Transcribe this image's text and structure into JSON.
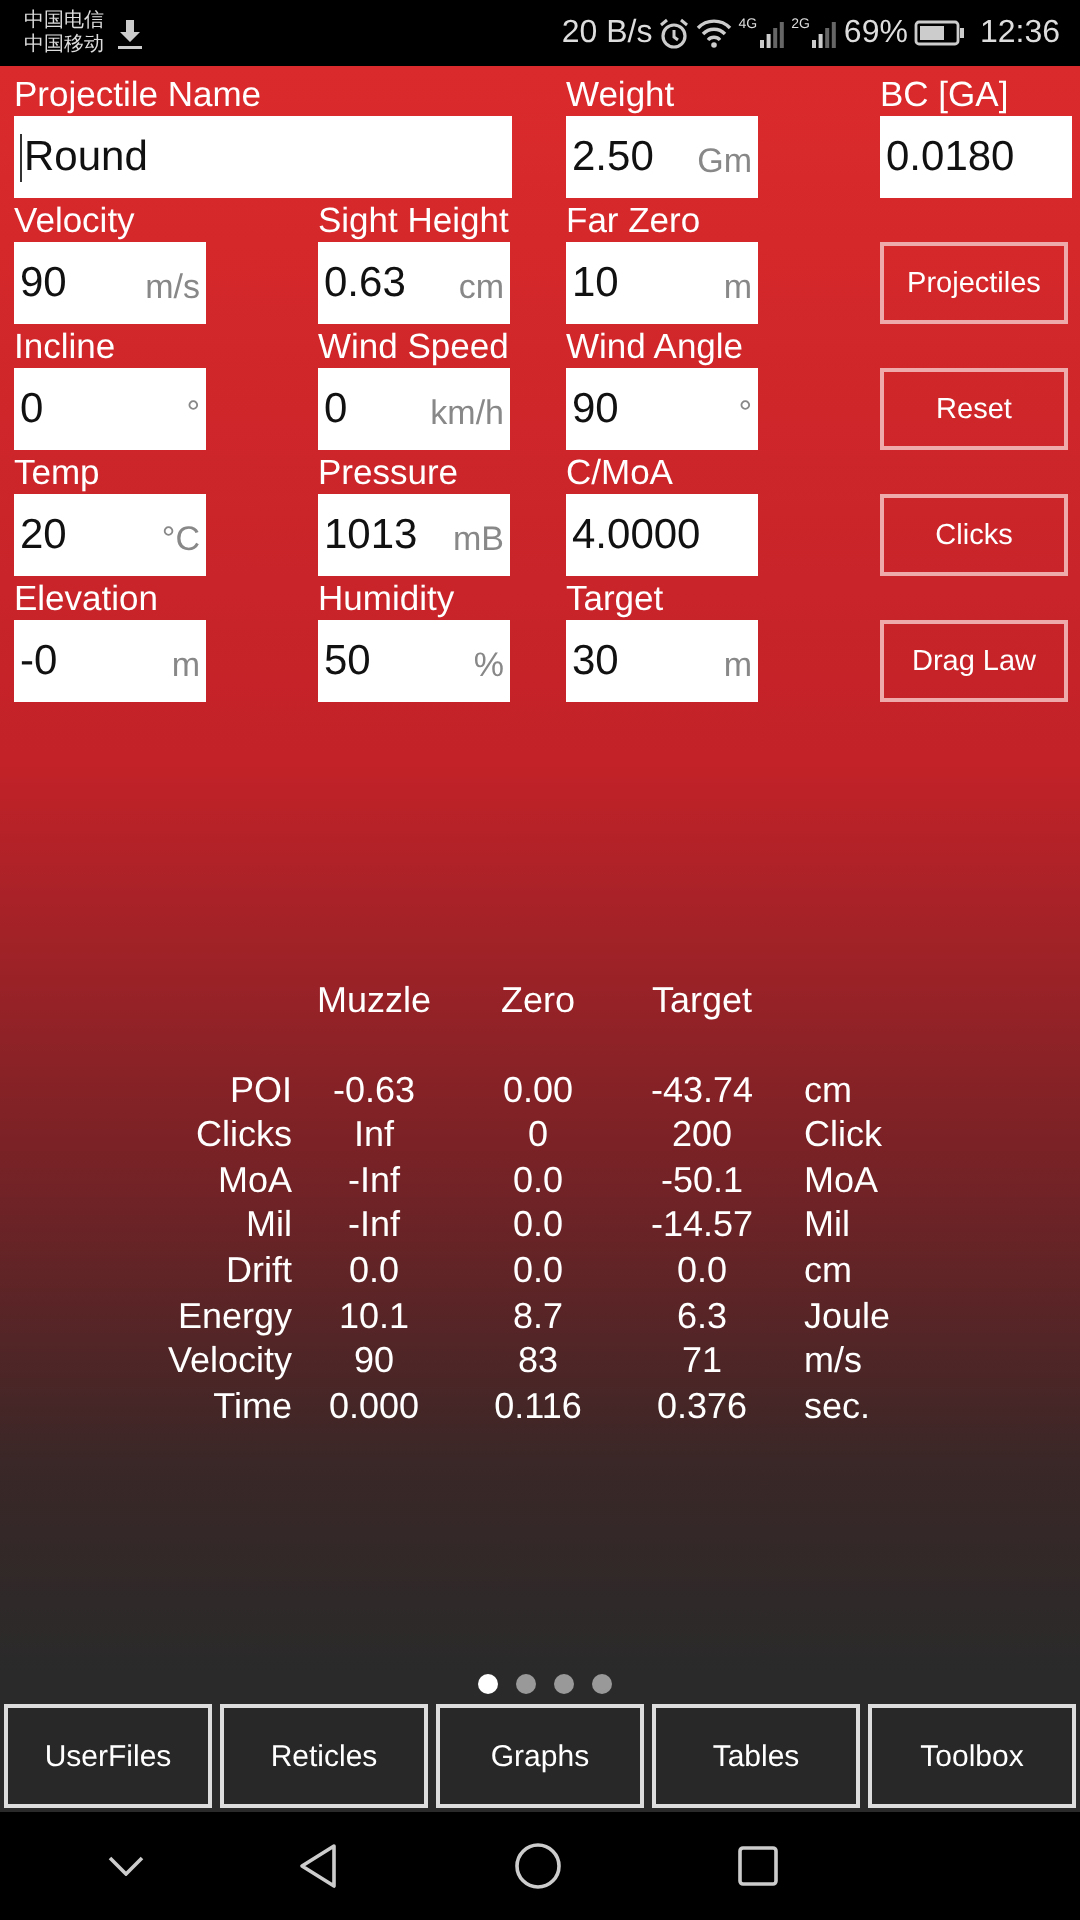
{
  "status_bar": {
    "carriers": [
      "中国电信",
      "中国移动"
    ],
    "speed": "20 B/s",
    "network_1": "4G",
    "network_2": "2G",
    "battery": "69%",
    "time": "12:36"
  },
  "input_rows": [
    {
      "fields": [
        {
          "label": "Projectile Name",
          "value": "Round",
          "kind": "wide",
          "focused": true
        },
        {
          "label": "Weight",
          "value": "2.50",
          "unit": "Gm",
          "kind": "normal",
          "focused": false
        },
        {
          "label": "BC [GA]",
          "value": "0.0180",
          "kind": "normal",
          "focused": false
        }
      ]
    },
    {
      "fields": [
        {
          "label": "Velocity",
          "value": "90",
          "unit": "m/s",
          "kind": "normal",
          "focused": false
        },
        {
          "label": "Sight Height",
          "value": "0.63",
          "unit": "cm",
          "kind": "normal",
          "focused": false
        },
        {
          "label": "Far Zero",
          "value": "10",
          "unit": "m",
          "kind": "normal",
          "focused": false
        }
      ],
      "button": "Projectiles"
    },
    {
      "fields": [
        {
          "label": "Incline",
          "value": "0",
          "unit": "°",
          "kind": "normal",
          "focused": false
        },
        {
          "label": "Wind Speed",
          "value": "0",
          "unit": "km/h",
          "kind": "normal",
          "focused": false
        },
        {
          "label": "Wind Angle",
          "value": "90",
          "unit": "°",
          "kind": "normal",
          "focused": false
        }
      ],
      "button": "Reset"
    },
    {
      "fields": [
        {
          "label": "Temp",
          "value": "20",
          "unit": "°C",
          "kind": "normal",
          "focused": false
        },
        {
          "label": "Pressure",
          "value": "1013",
          "unit": "mB",
          "kind": "normal",
          "focused": false
        },
        {
          "label": "C/MoA",
          "value": "4.0000",
          "kind": "normal",
          "focused": false
        }
      ],
      "button": "Clicks"
    },
    {
      "fields": [
        {
          "label": "Elevation",
          "value": "-0",
          "unit": "m",
          "kind": "normal",
          "focused": false
        },
        {
          "label": "Humidity",
          "value": "50",
          "unit": "%",
          "kind": "normal",
          "focused": false
        },
        {
          "label": "Target",
          "value": "30",
          "unit": "m",
          "kind": "normal",
          "focused": false
        }
      ],
      "button": "Drag Law"
    }
  ],
  "results": {
    "columns": [
      "Muzzle",
      "Zero",
      "Target"
    ],
    "rows": [
      {
        "label": "POI",
        "values": [
          "-0.63",
          "0.00",
          "-43.74"
        ],
        "unit": "cm"
      },
      {
        "label": "Clicks",
        "values": [
          "Inf",
          "0",
          "200"
        ],
        "unit": "Click"
      },
      {
        "label": "MoA",
        "values": [
          "-Inf",
          "0.0",
          "-50.1"
        ],
        "unit": "MoA"
      },
      {
        "label": "Mil",
        "values": [
          "-Inf",
          "0.0",
          "-14.57"
        ],
        "unit": "Mil"
      },
      {
        "label": "Drift",
        "values": [
          "0.0",
          "0.0",
          "0.0"
        ],
        "unit": "cm"
      },
      {
        "label": "Energy",
        "values": [
          "10.1",
          "8.7",
          "6.3"
        ],
        "unit": "Joule"
      },
      {
        "label": "Velocity",
        "values": [
          "90",
          "83",
          "71"
        ],
        "unit": "m/s"
      },
      {
        "label": "Time",
        "values": [
          "0.000",
          "0.116",
          "0.376"
        ],
        "unit": "sec."
      }
    ]
  },
  "page_dots": [
    {
      "selected": true
    },
    {
      "selected": false
    },
    {
      "selected": false
    },
    {
      "selected": false
    }
  ],
  "bottom_buttons": [
    "UserFiles",
    "Reticles",
    "Graphs",
    "Tables",
    "Toolbox"
  ]
}
